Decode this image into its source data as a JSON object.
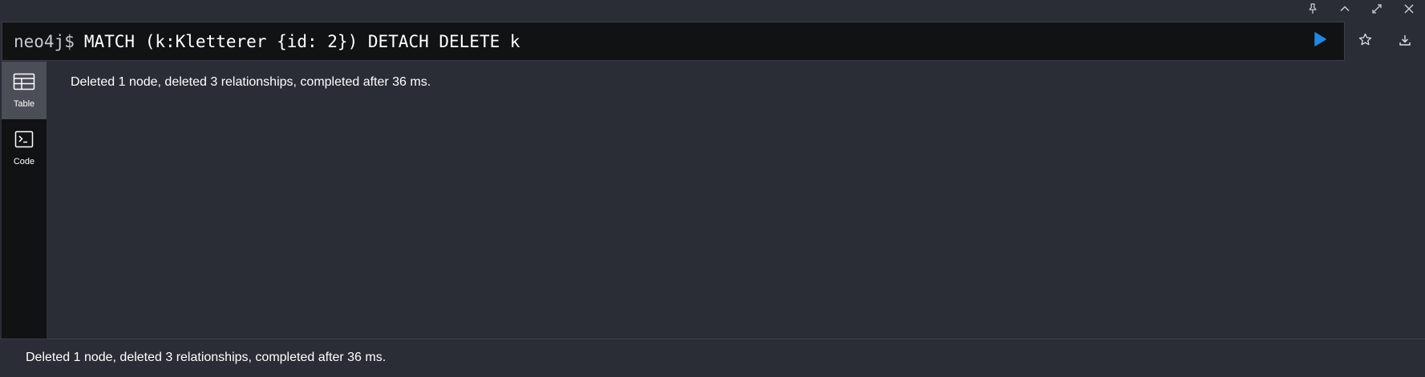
{
  "window_controls": {
    "icons": [
      "pin-icon",
      "collapse-icon",
      "fullscreen-icon",
      "close-icon"
    ]
  },
  "editor": {
    "prompt": "neo4j$",
    "query": "MATCH (k:Kletterer {id: 2}) DETACH DELETE k"
  },
  "colors": {
    "accent": "#1e88e5",
    "background": "#2a2d35",
    "panel_dark": "#111214",
    "active_tab": "#4b4d57"
  },
  "sidebar": {
    "tabs": [
      {
        "label": "Table",
        "icon": "table-icon",
        "active": true
      },
      {
        "label": "Code",
        "icon": "code-icon",
        "active": false
      }
    ]
  },
  "result": {
    "message": "Deleted 1 node, deleted 3 relationships, completed after 36 ms."
  },
  "status": {
    "message": "Deleted 1 node, deleted 3 relationships, completed after 36 ms."
  }
}
